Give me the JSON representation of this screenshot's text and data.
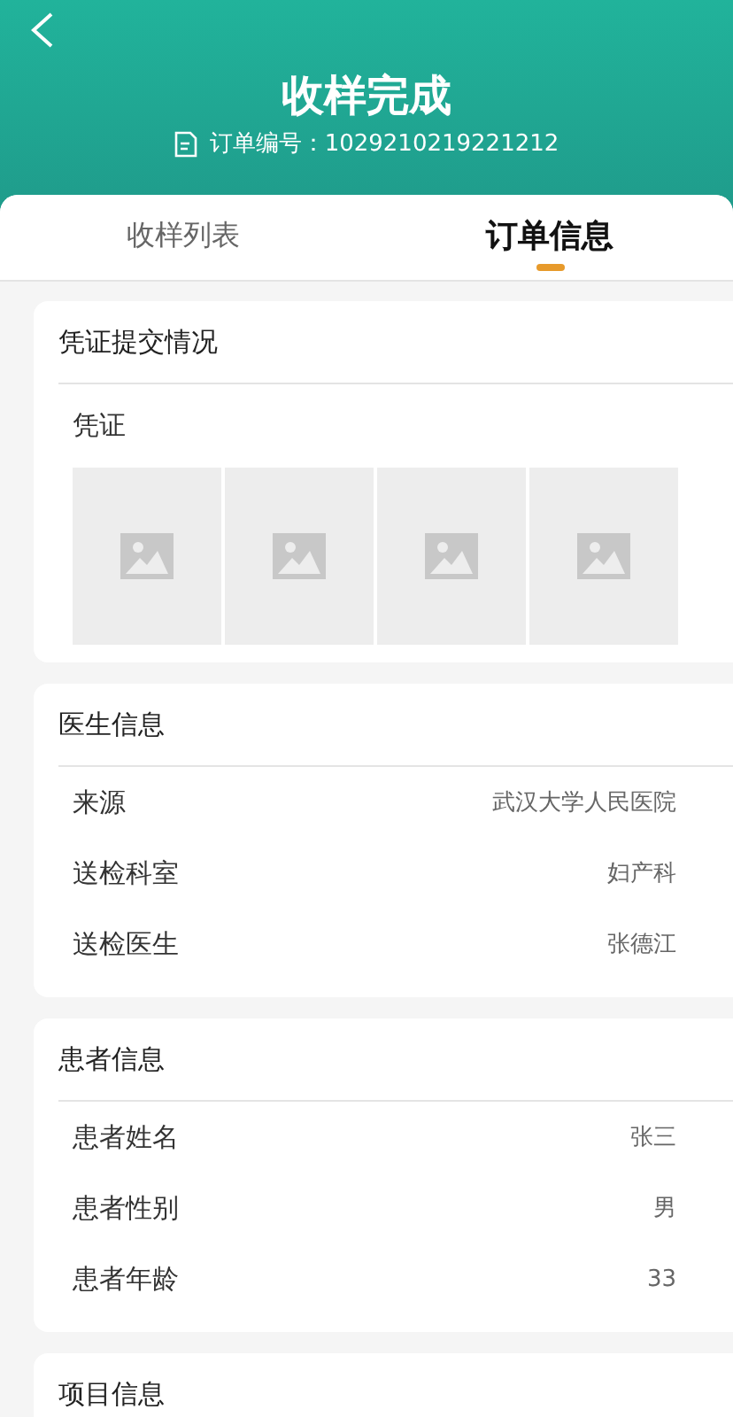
{
  "header": {
    "title": "收样完成",
    "order_label": "订单编号：",
    "order_number": "1029210219221212"
  },
  "tabs": [
    {
      "label": "收样列表",
      "selected": false
    },
    {
      "label": "订单信息",
      "selected": true
    }
  ],
  "sections": [
    {
      "kind": "images",
      "title": "凭证提交情况",
      "subtitle": "凭证",
      "images": [
        {
          "kind": "placeholder"
        },
        {
          "kind": "placeholder"
        },
        {
          "kind": "placeholder"
        },
        {
          "kind": "placeholder"
        }
      ]
    },
    {
      "kind": "rows",
      "title": "医生信息",
      "rows": [
        {
          "label": "来源",
          "value": "武汉大学人民医院"
        },
        {
          "label": "送检科室",
          "value": "妇产科"
        },
        {
          "label": "送检医生",
          "value": "张德江"
        }
      ]
    },
    {
      "kind": "rows",
      "title": "患者信息",
      "rows": [
        {
          "label": "患者姓名",
          "value": "张三"
        },
        {
          "label": "患者性别",
          "value": "男"
        },
        {
          "label": "患者年龄",
          "value": "33"
        }
      ]
    },
    {
      "kind": "rows",
      "title": "项目信息"
    }
  ]
}
